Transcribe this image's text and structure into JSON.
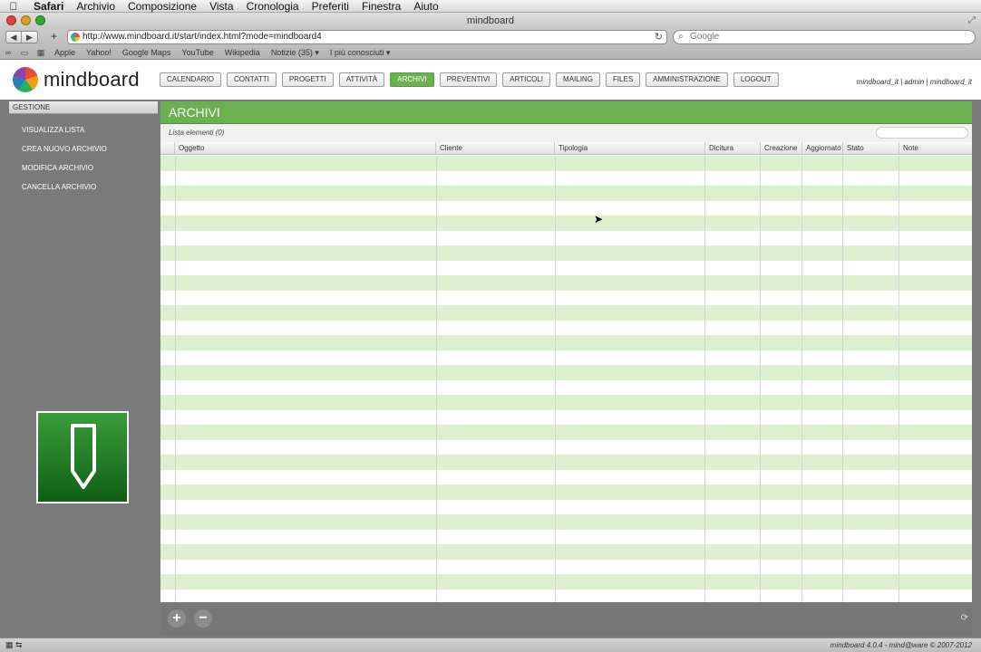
{
  "menubar": {
    "items": [
      "Safari",
      "Archivio",
      "Composizione",
      "Vista",
      "Cronologia",
      "Preferiti",
      "Finestra",
      "Aiuto"
    ]
  },
  "window": {
    "title": "mindboard"
  },
  "browser": {
    "url": "http://www.mindboard.it/start/index.html?mode=mindboard4",
    "search_placeholder": "Google",
    "bookmarks": [
      "Apple",
      "Yahoo!",
      "Google Maps",
      "YouTube",
      "Wikipedia",
      "Notizie (35) ▾",
      "I più conosciuti ▾"
    ]
  },
  "app": {
    "logo_text": "mindboard",
    "nav": [
      "CALENDARIO",
      "CONTATTI",
      "PROGETTI",
      "ATTIVITÀ",
      "ARCHIVI",
      "PREVENTIVI",
      "ARTICOLI",
      "MAILING",
      "FILES",
      "AMMINISTRAZIONE",
      "LOGOUT"
    ],
    "active_nav": "ARCHIVI",
    "user_line": "mindboard_it | admin | mindboard_it",
    "sidebar": {
      "heading": "GESTIONE",
      "items": [
        "VISUALIZZA LISTA",
        "CREA NUOVO ARCHIVIO",
        "MODIFICA ARCHIVIO",
        "CANCELLA ARCHIVIO"
      ]
    },
    "main": {
      "title": "ARCHIVI",
      "list_count": "Lista elementi (0)",
      "columns": [
        "",
        "Oggetto",
        "Cliente",
        "Tipologia",
        "Dicitura",
        "Creazione",
        "Aggiornato",
        "Stato",
        "Note"
      ]
    },
    "footer": {
      "add": "+",
      "remove": "−"
    }
  },
  "status": {
    "copyright": "mindboard 4.0.4 - mind@ware © 2007-2012"
  },
  "colors": {
    "accent": "#6ab24f",
    "row_alt": "#dcefcf"
  }
}
